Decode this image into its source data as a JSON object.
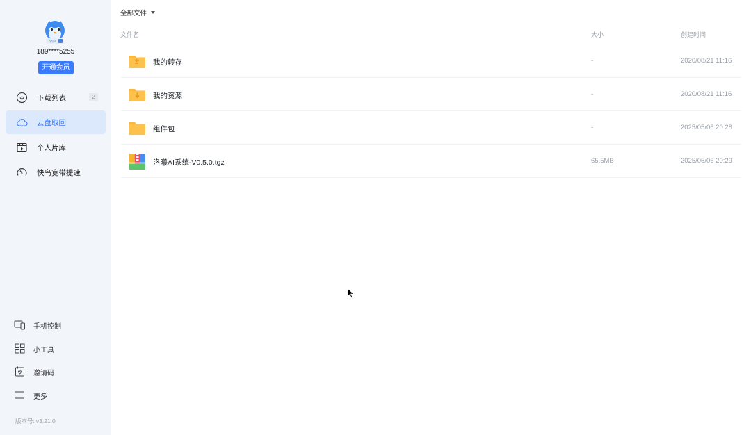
{
  "sidebar": {
    "avatar_icon": "bird-mascot-vip-avatar",
    "phone": "189****5255",
    "vip_button": "开通会员",
    "nav": [
      {
        "label": "下载列表",
        "icon": "download-icon",
        "badge": "2"
      },
      {
        "label": "云盘取回",
        "icon": "cloud-icon",
        "active": true
      },
      {
        "label": "个人片库",
        "icon": "video-library-icon"
      },
      {
        "label": "快鸟宽带提速",
        "icon": "speedometer-icon"
      }
    ],
    "bottom": [
      {
        "label": "手机控制",
        "icon": "phone-control-icon"
      },
      {
        "label": "小工具",
        "icon": "grid-tools-icon"
      },
      {
        "label": "邀请码",
        "icon": "invite-code-icon"
      },
      {
        "label": "更多",
        "icon": "menu-icon"
      }
    ],
    "version_label": "版本号:",
    "version_value": "v3.21.0"
  },
  "main": {
    "breadcrumb": "全部文件",
    "columns": {
      "name": "文件名",
      "size": "大小",
      "time": "创建时间"
    },
    "files": [
      {
        "name": "我的转存",
        "size": "-",
        "time": "2020/08/21 11:16",
        "icon": "folder-transfer-icon"
      },
      {
        "name": "我的资源",
        "size": "-",
        "time": "2020/08/21 11:16",
        "icon": "folder-download-icon"
      },
      {
        "name": "组件包",
        "size": "-",
        "time": "2025/05/06 20:28",
        "icon": "folder-icon"
      },
      {
        "name": "洛曦AI系统-V0.5.0.tgz",
        "size": "65.5MB",
        "time": "2025/05/06 20:29",
        "icon": "archive-file-icon"
      }
    ]
  },
  "colors": {
    "accent": "#3a7afe",
    "sidebar_bg": "#f2f5fa",
    "active_bg": "#dce8fb",
    "folder": "#fcc24d"
  }
}
